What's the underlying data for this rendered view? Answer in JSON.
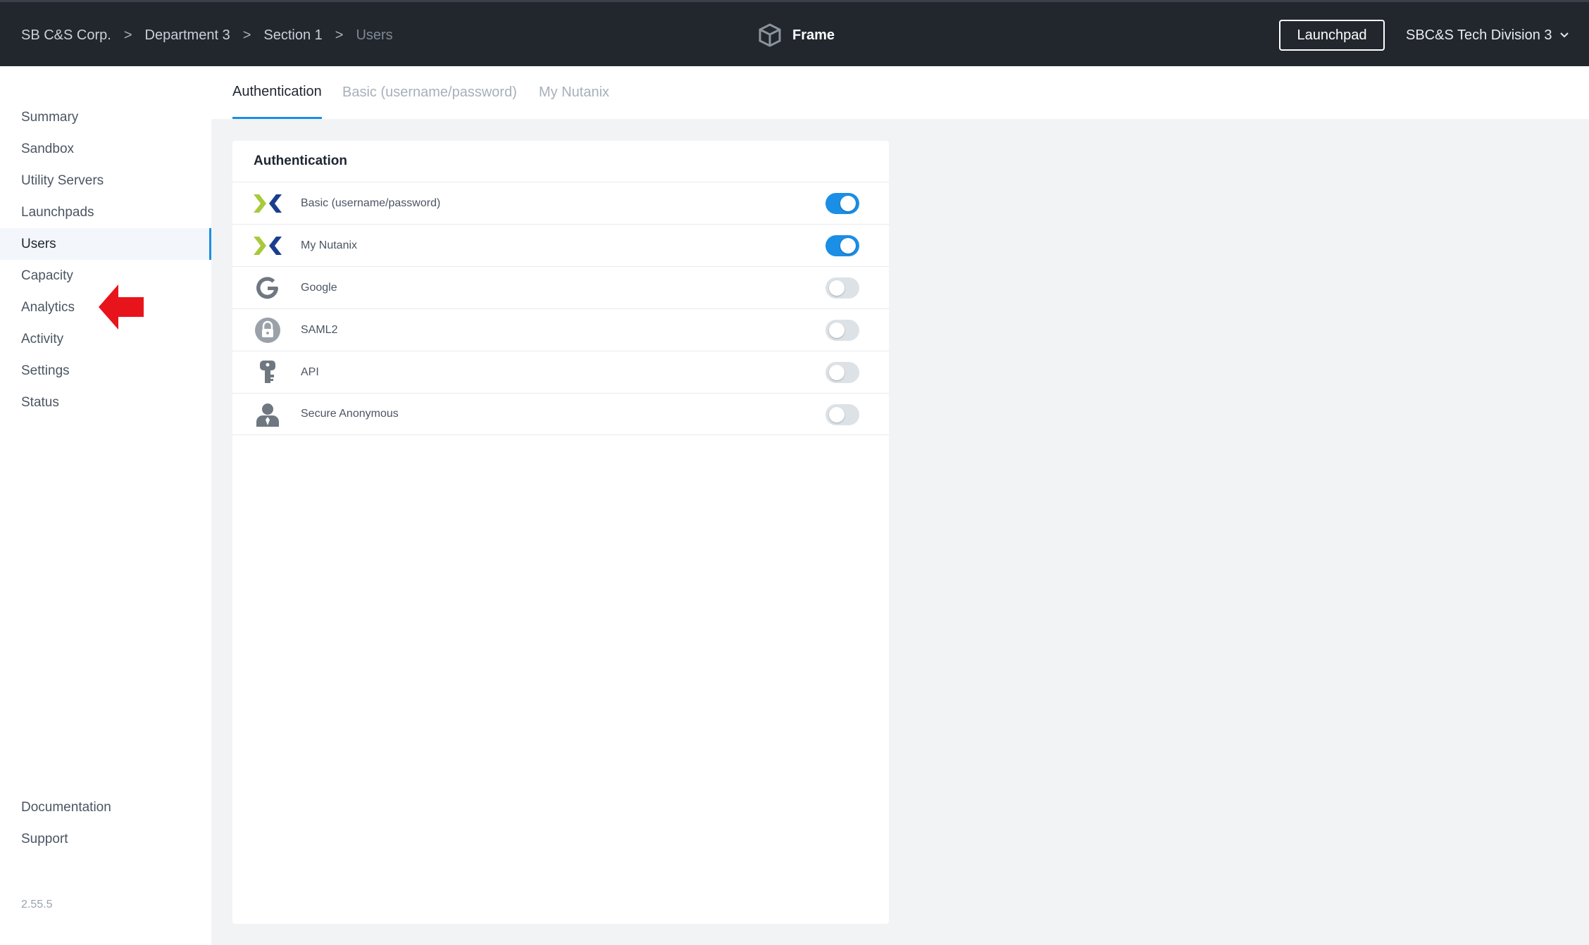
{
  "header": {
    "breadcrumb": [
      "SB C&S Corp.",
      "Department 3",
      "Section 1",
      "Users"
    ],
    "separator": ">",
    "app_name": "Frame",
    "launchpad_button": "Launchpad",
    "account": "SBC&S Tech Division 3"
  },
  "sidebar": {
    "items": [
      "Summary",
      "Sandbox",
      "Utility Servers",
      "Launchpads",
      "Users",
      "Capacity",
      "Analytics",
      "Activity",
      "Settings",
      "Status"
    ],
    "active_index": 4,
    "bottom_items": [
      "Documentation",
      "Support"
    ],
    "version": "2.55.5"
  },
  "tabs": [
    "Authentication",
    "Basic (username/password)",
    "My Nutanix"
  ],
  "active_tab": 0,
  "card": {
    "title": "Authentication",
    "providers": [
      {
        "label": "Basic (username/password)",
        "icon": "nutanix-icon",
        "enabled": true
      },
      {
        "label": "My Nutanix",
        "icon": "nutanix-icon",
        "enabled": true
      },
      {
        "label": "Google",
        "icon": "google-icon",
        "enabled": false
      },
      {
        "label": "SAML2",
        "icon": "lock-icon",
        "enabled": false
      },
      {
        "label": "API",
        "icon": "key-icon",
        "enabled": false
      },
      {
        "label": "Secure Anonymous",
        "icon": "user-icon",
        "enabled": false
      }
    ]
  },
  "colors": {
    "accent": "#1b8ee6",
    "topbar": "#22272e",
    "annotation_arrow": "#e8141b",
    "nutanix_green": "#a9c93b",
    "nutanix_blue": "#1a3d8f"
  }
}
